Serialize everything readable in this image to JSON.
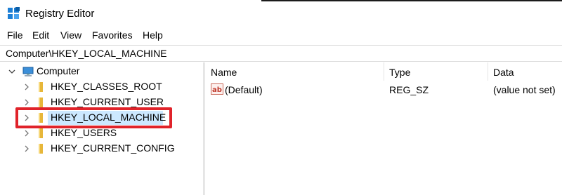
{
  "window": {
    "title": "Registry Editor"
  },
  "menu": [
    "File",
    "Edit",
    "View",
    "Favorites",
    "Help"
  ],
  "address": "Computer\\HKEY_LOCAL_MACHINE",
  "tree": {
    "root": "Computer",
    "items": [
      "HKEY_CLASSES_ROOT",
      "HKEY_CURRENT_USER",
      "HKEY_LOCAL_MACHINE",
      "HKEY_USERS",
      "HKEY_CURRENT_CONFIG"
    ],
    "selected": "HKEY_LOCAL_MACHINE"
  },
  "list": {
    "columns": [
      "Name",
      "Type",
      "Data"
    ],
    "rows": [
      {
        "name": "(Default)",
        "type": "REG_SZ",
        "data": "(value not set)"
      }
    ]
  },
  "colors": {
    "selection": "#cce8ff",
    "highlight": "#e0232a",
    "folder": "#f2c94c"
  },
  "icons": {
    "app": "registry-icon",
    "computer": "computer-icon",
    "folder": "folder-icon",
    "value": "string-value-icon"
  }
}
